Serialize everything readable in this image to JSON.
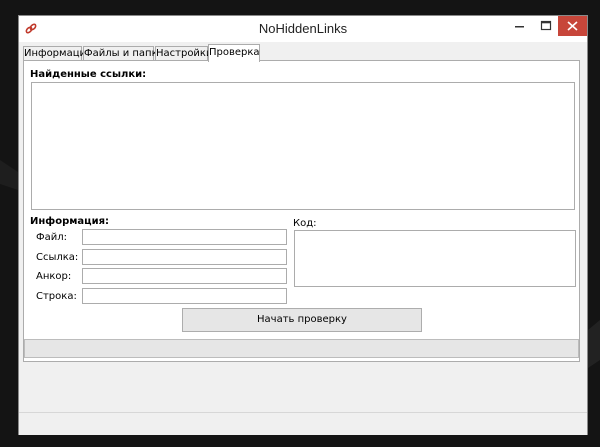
{
  "window": {
    "title": "NoHiddenLinks",
    "accent_color": "#c0392b"
  },
  "tabs": [
    {
      "label": "Информация",
      "active": false
    },
    {
      "label": "Файлы и папки",
      "active": false
    },
    {
      "label": "Настройки",
      "active": false
    },
    {
      "label": "Проверка",
      "active": true
    }
  ],
  "check_tab": {
    "found_links_label": "Найденные ссылки:",
    "found_links": [],
    "info_label": "Информация:",
    "code_label": "Код:",
    "fields": [
      {
        "label": "Файл:",
        "value": ""
      },
      {
        "label": "Ссылка:",
        "value": ""
      },
      {
        "label": "Анкор:",
        "value": ""
      },
      {
        "label": "Строка:",
        "value": ""
      }
    ],
    "code_value": "",
    "start_button": "Начать проверку",
    "progress": 0
  },
  "icons": [
    "app-link-icon",
    "minimize-icon",
    "maximize-icon",
    "close-icon"
  ]
}
